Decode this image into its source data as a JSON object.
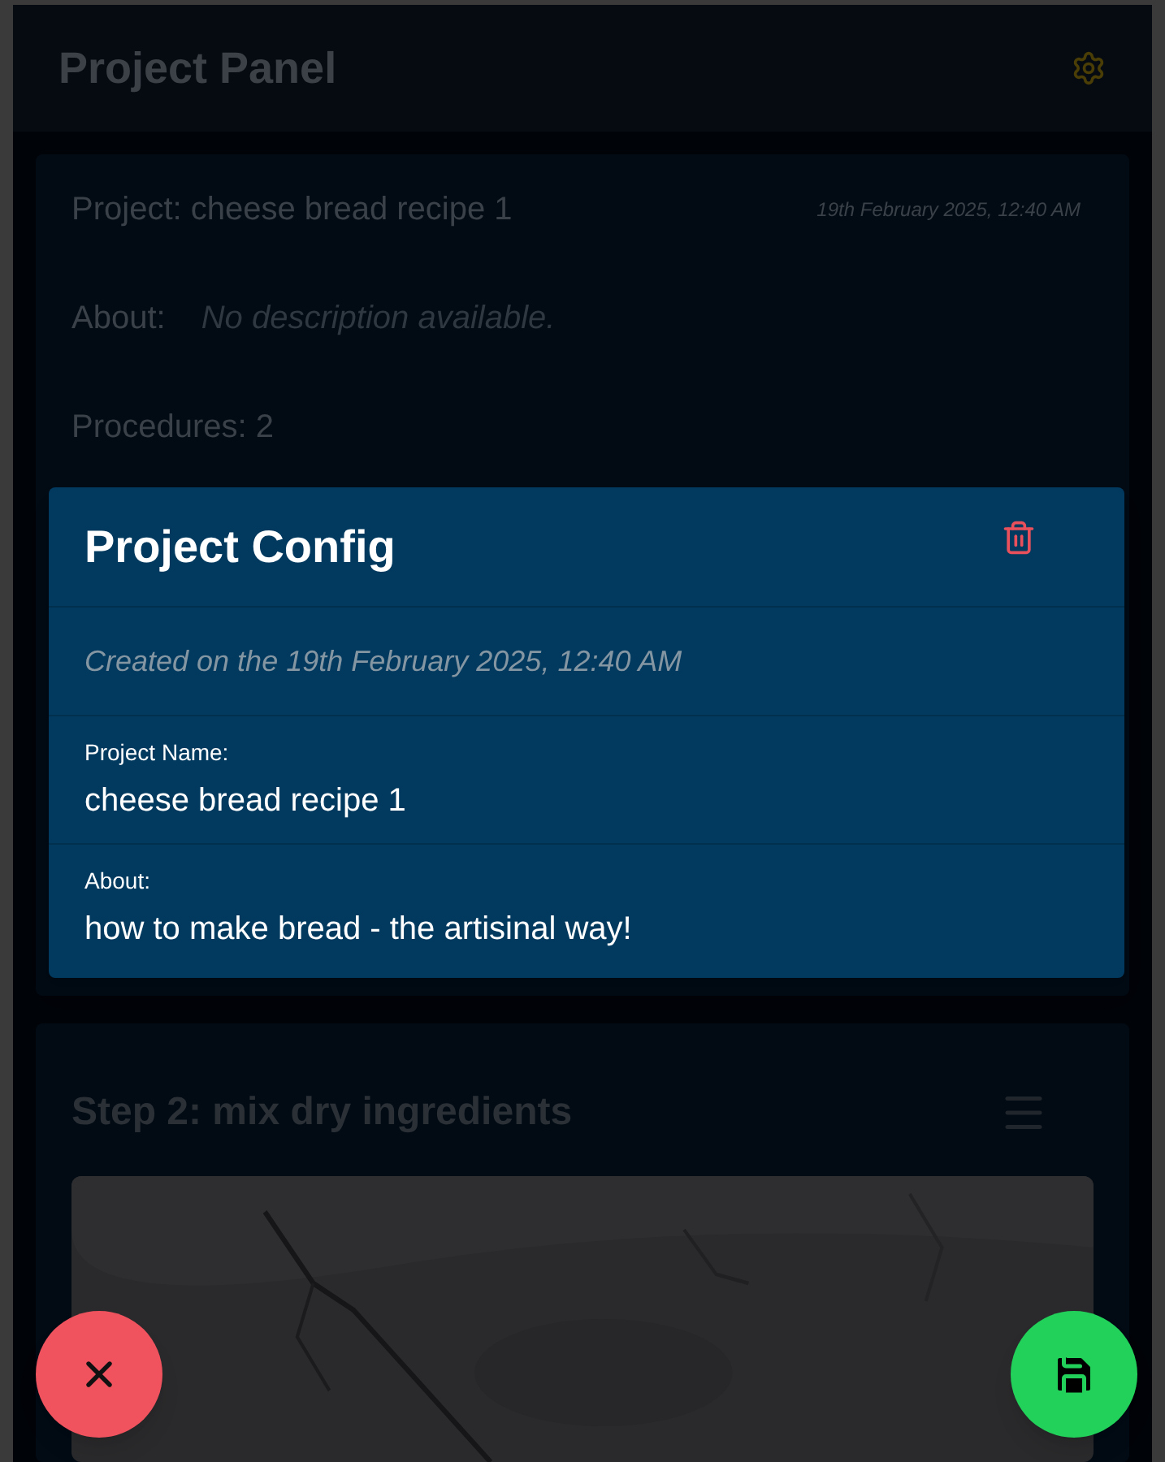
{
  "header": {
    "title": "Project Panel"
  },
  "project_card": {
    "title": "Project: cheese bread recipe 1",
    "date": "19th February 2025, 12:40 AM",
    "about_label": "About:",
    "about_value": "No description available.",
    "procedures": "Procedures: 2"
  },
  "step_card": {
    "title": "Step 2: mix dry ingredients"
  },
  "dialog": {
    "title": "Project Config",
    "created": "Created on the 19th February 2025, 12:40 AM",
    "fields": [
      {
        "label": "Project Name:",
        "value": "cheese bread recipe 1"
      },
      {
        "label": "About:",
        "value": "how to make bread - the artisinal way!"
      }
    ]
  }
}
